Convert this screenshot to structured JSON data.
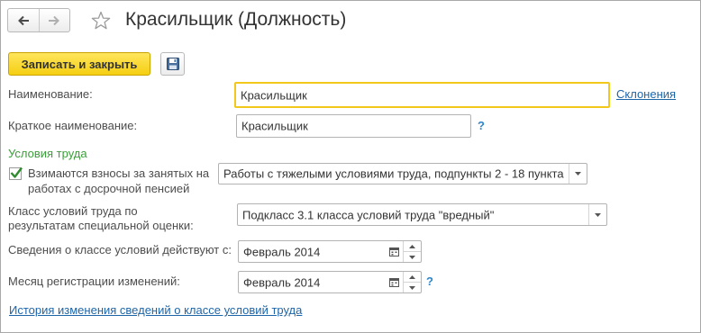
{
  "header": {
    "title": "Красильщик (Должность)",
    "back_icon": "arrow-left-icon",
    "forward_icon": "arrow-right-icon",
    "favorite_icon": "star-icon"
  },
  "toolbar": {
    "save_close_label": "Записать и закрыть",
    "save_icon": "floppy-disk-icon"
  },
  "form": {
    "name_label": "Наименование:",
    "name_value": "Красильщик",
    "declensions_link": "Склонения",
    "short_name_label": "Краткое наименование:",
    "short_name_value": "Красильщик",
    "help_mark": "?",
    "section_title": "Условия труда",
    "contributions_label_line1": "Взимаются взносы за занятых на",
    "contributions_label_line2": "работах с досрочной пенсией",
    "contributions_checked": true,
    "contributions_value": "Работы с тяжелыми условиями труда, подпункты 2 - 18 пункта",
    "class_label_line1": "Класс условий труда по",
    "class_label_line2": "результатам специальной оценки:",
    "class_value": "Подкласс 3.1 класса условий труда \"вредный\"",
    "effective_label": "Сведения о классе условий действуют с:",
    "effective_value": "Февраль 2014",
    "reg_month_label": "Месяц регистрации изменений:",
    "reg_month_value": "Февраль 2014",
    "history_link": "История изменения сведений о классе условий труда"
  },
  "colors": {
    "accent_yellow": "#f5cf12",
    "link_blue": "#1e65a8",
    "section_green": "#3b9e3b",
    "focus_border": "#f2c81a"
  }
}
